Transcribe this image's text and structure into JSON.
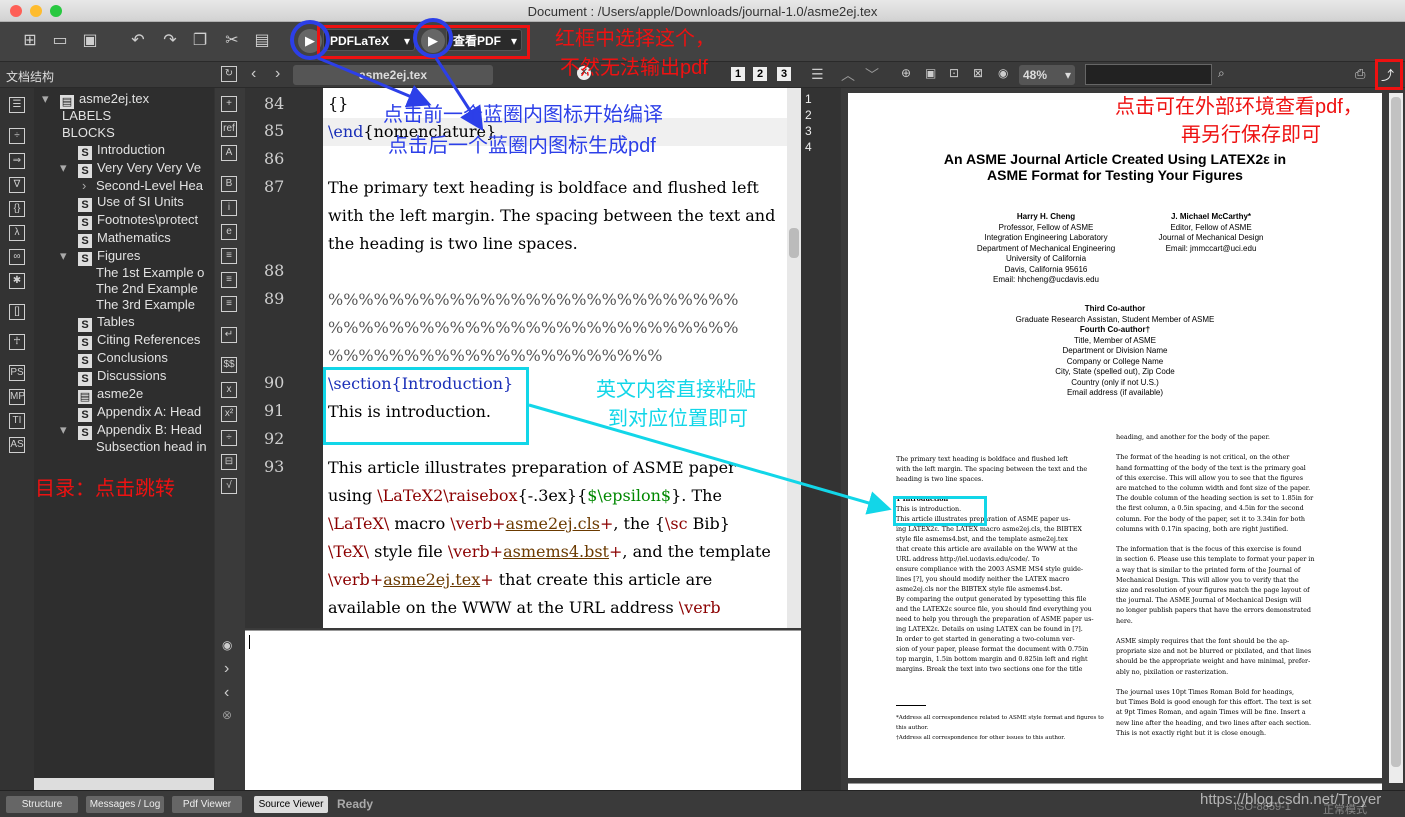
{
  "window": {
    "title": "Document : /Users/apple/Downloads/journal-1.0/asme2ej.tex"
  },
  "toolbar": {
    "compiler": "PDFLaTeX",
    "viewer": "查看PDF"
  },
  "annotations": {
    "red_top": "红框中选择这个，",
    "red_top2": "不然无法输出pdf",
    "blue1": "点击前一个蓝圈内图标开始编译",
    "blue2": "点击后一个蓝圈内图标生成pdf",
    "cyan1": "英文内容直接粘贴",
    "cyan2": "到对应位置即可",
    "red_right1": "点击可在外部环境查看pdf，",
    "red_right2": "再另行保存即可",
    "red_left": "目录：点击跳转"
  },
  "structure": {
    "header": "文档结构",
    "items": [
      {
        "label": "asme2ej.tex",
        "icon": "file-icon"
      },
      {
        "label": "LABELS",
        "icon": ""
      },
      {
        "label": "BLOCKS",
        "icon": ""
      },
      {
        "label": "Introduction",
        "icon": "S"
      },
      {
        "label": "Very Very Very Ve",
        "icon": "S"
      },
      {
        "label": "Second-Level Hea",
        "icon": ""
      },
      {
        "label": "Use of SI Units",
        "icon": "S"
      },
      {
        "label": "Footnotes\\protect",
        "icon": "S"
      },
      {
        "label": "Mathematics",
        "icon": "S"
      },
      {
        "label": "Figures",
        "icon": "S"
      },
      {
        "label": "The 1st Example o",
        "icon": ""
      },
      {
        "label": "The 2nd Example",
        "icon": ""
      },
      {
        "label": "The 3rd Example",
        "icon": ""
      },
      {
        "label": "Tables",
        "icon": "S"
      },
      {
        "label": "Citing References",
        "icon": "S"
      },
      {
        "label": "Conclusions",
        "icon": "S"
      },
      {
        "label": "Discussions",
        "icon": "S"
      },
      {
        "label": "asme2e",
        "icon": "file-icon"
      },
      {
        "label": "Appendix A: Head",
        "icon": "S"
      },
      {
        "label": "Appendix B: Head",
        "icon": "S"
      },
      {
        "label": "Subsection head in",
        "icon": ""
      }
    ]
  },
  "editor": {
    "tab": "asme2ej.tex",
    "line_numbers": [
      "84",
      "85",
      "86",
      "87",
      "88",
      "89",
      "90",
      "91",
      "92",
      "93"
    ],
    "lines": {
      "l84": "{}",
      "l85a": "\\end",
      "l85b": "{nomenclature}",
      "l87a": "The primary text heading is  boldface and flushed left",
      "l87b": "with the left margin.  The spacing between the  text and",
      "l87c": "the heading is two line spaces.",
      "l89a": "%%%%%%%%%%%%%%%%%%%%%%%%%%%",
      "l89b": "%%%%%%%%%%%%%%%%%%%%%%%%%%%",
      "l89c": "%%%%%%%%%%%%%%%%%%%%%%",
      "l90": "\\section{Introduction}",
      "l91": "This is introduction.",
      "l93a": "This article illustrates preparation of ASME paper",
      "l93b1": "using ",
      "l93b2": "\\LaTeX2\\raisebox",
      "l93b3": "{-.3ex}{",
      "l93b4": "$\\epsilon$",
      "l93b5": "}. The",
      "l93c1": "\\LaTeX\\",
      "l93c2": "  macro ",
      "l93c3": "\\verb+",
      "l93c4": "asme2ej.cls",
      "l93c5": "+",
      "l93c6": ", the {",
      "l93c7": "\\sc",
      "l93c8": " Bib}",
      "l93d1": "\\TeX\\",
      "l93d2": " style file ",
      "l93d3": "\\verb+",
      "l93d4": "asmems4.bst",
      "l93d5": "+",
      "l93d6": ", and the template",
      "l93e1": "\\verb+",
      "l93e2": "asme2ej.tex",
      "l93e3": "+",
      "l93e4": " that create this article are",
      "l93f1": "available on the WWW  at the URL address ",
      "l93f2": "\\verb"
    }
  },
  "pdf": {
    "zoom": "48%",
    "page_numbers": [
      "1",
      "2",
      "3",
      "4"
    ],
    "title1": "An ASME Journal Article Created Using LATEX2ε in",
    "title2": "ASME Format for Testing Your Figures",
    "author1": [
      "Harry H. Cheng",
      "Professor, Fellow of ASME",
      "Integration Engineering Laboratory",
      "Department of Mechanical Engineering",
      "University of California",
      "Davis, California 95616",
      "Email: hhcheng@ucdavis.edu"
    ],
    "author2": [
      "J. Michael McCarthy*",
      "Editor, Fellow of ASME",
      "Journal of Mechanical Design",
      "Email: jmmccart@uci.edu"
    ],
    "author3": [
      "Third Co-author",
      "Graduate Research Assistan, Student Member of ASME",
      "Fourth Co-author†",
      "Title, Member of ASME",
      "Department or Division Name",
      "Company or College Name",
      "City, State (spelled out), Zip Code",
      "Country (only if not U.S.)",
      "Email address (if available)"
    ],
    "left_col": [
      "The primary text heading is boldface and flushed left",
      "with the left margin. The spacing between the text and the",
      "heading is two line spaces.",
      "",
      "1   Introduction",
      "     This is introduction.",
      "     This article illustrates preparation of ASME paper us-",
      "ing LATEX2ε. The LATEX macro asme2ej.cls, the BIBTEX",
      "style file asmems4.bst, and the template asme2ej.tex",
      "that create this article are available on the WWW at the",
      "URL address http://iel.ucdavis.edu/code/. To",
      "ensure compliance with the 2003 ASME MS4 style guide-",
      "lines [?], you should modify neither the LATEX macro",
      "asme2ej.cls nor the BIBTEX style file asmems4.bst.",
      "By comparing the output generated by typesetting this file",
      "and the LATEX2ε source file, you should find everything you",
      "need to help you through the preparation of ASME paper us-",
      "ing LATEX2ε. Details on using LATEX can be found in [?].",
      "     In order to get started in generating a two-column ver-",
      "sion of your paper, please format the document with 0.75in",
      "top margin, 1.5in bottom margin and 0.825in left and right",
      "margins.  Break the text into two sections one for the title"
    ],
    "footnotes": [
      "*Address all correspondence related to ASME style format and figures to this author.",
      "†Address all correspondence for other issues to this author."
    ],
    "right_col": [
      "heading, and another for the body of the paper.",
      "",
      "     The format of the heading is not critical, on the other",
      "hand formatting of the body of the text is the primary goal",
      "of this exercise. This will allow you to see that the figures",
      "are matched to the column width and font size of the paper.",
      "The double column of the heading section is set to 1.85in for",
      "the first column, a 0.5in spacing, and 4.5in for the second",
      "column. For the body of the paper, set it to 3.34in for both",
      "columns with 0.17in spacing, both are right justified.",
      "",
      "     The information that is the focus of this exercise is found",
      "in section 6. Please use this template to format your paper in",
      "a way that is similar to the printed form of the Journal of",
      "Mechanical Design. This will allow you to verify that the",
      "size and resolution of your figures match the page layout of",
      "the journal. The ASME Journal of Mechanical Design will",
      "no longer publish papers that have the errors demonstrated",
      "here.",
      "",
      "     ASME simply requires that the font should be the ap-",
      "propriate size and not be blurred or pixilated, and that lines",
      "should be the appropriate weight and have minimal, prefer-",
      "ably no, pixilation or rasterization.",
      "",
      "     The journal uses 10pt Times Roman Bold for headings,",
      "but Times Bold is good enough for this effort. The text is set",
      "at 9pt Times Roman, and again Times will be fine.  Insert a",
      "new line after the heading, and two lines after each section.",
      "This is not exactly right but it is close enough."
    ]
  },
  "statusbar": {
    "tabs": [
      "Structure",
      "Messages / Log",
      "Pdf Viewer",
      "Source Viewer"
    ],
    "status": "Ready",
    "encoding": "ISO-8859-1",
    "mode": "正常模式",
    "watermark": "https://blog.csdn.net/Troyer"
  }
}
